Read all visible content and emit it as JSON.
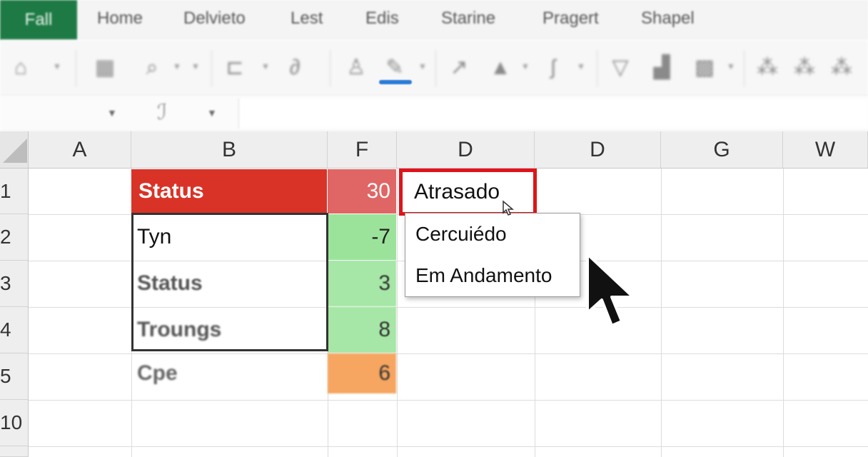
{
  "ribbon": {
    "file_tab": "Fall",
    "tabs": [
      "Home",
      "Delvieto",
      "Lest",
      "Edis",
      "Starine",
      "Pragert",
      "Shapel"
    ]
  },
  "toolbar": {
    "icons": [
      "borders-icon",
      "table-grid-icon",
      "format-brush-icon",
      "shape-icon",
      "link-icon",
      "person-icon",
      "fill-color-icon",
      "arrow-line-icon",
      "triangle-icon",
      "curve-icon",
      "filter-icon",
      "chart-icon",
      "grid-fill-icon",
      "wand-icon",
      "wand-icon",
      "wand-icon"
    ],
    "fill_underline_color": "#2b7bd8"
  },
  "grid": {
    "columns": [
      "A",
      "B",
      "F",
      "D",
      "D",
      "G",
      "W"
    ],
    "rows": [
      "1",
      "2",
      "3",
      "4",
      "5",
      "10"
    ],
    "b_cells": [
      "Status",
      "Tyn",
      "Status",
      "Troungs",
      "Cpe"
    ],
    "f_cells": [
      "30",
      "-7",
      "3",
      "8",
      "6"
    ],
    "d1_value": "Atrasado",
    "colors": {
      "header_red": "#d93328",
      "f1_red": "#e06666",
      "green": "#9be39b",
      "orange": "#f6a661",
      "active_border": "#e0141b"
    }
  },
  "dropdown": {
    "options": [
      "Cercuiédo",
      "Em Andamento"
    ]
  }
}
